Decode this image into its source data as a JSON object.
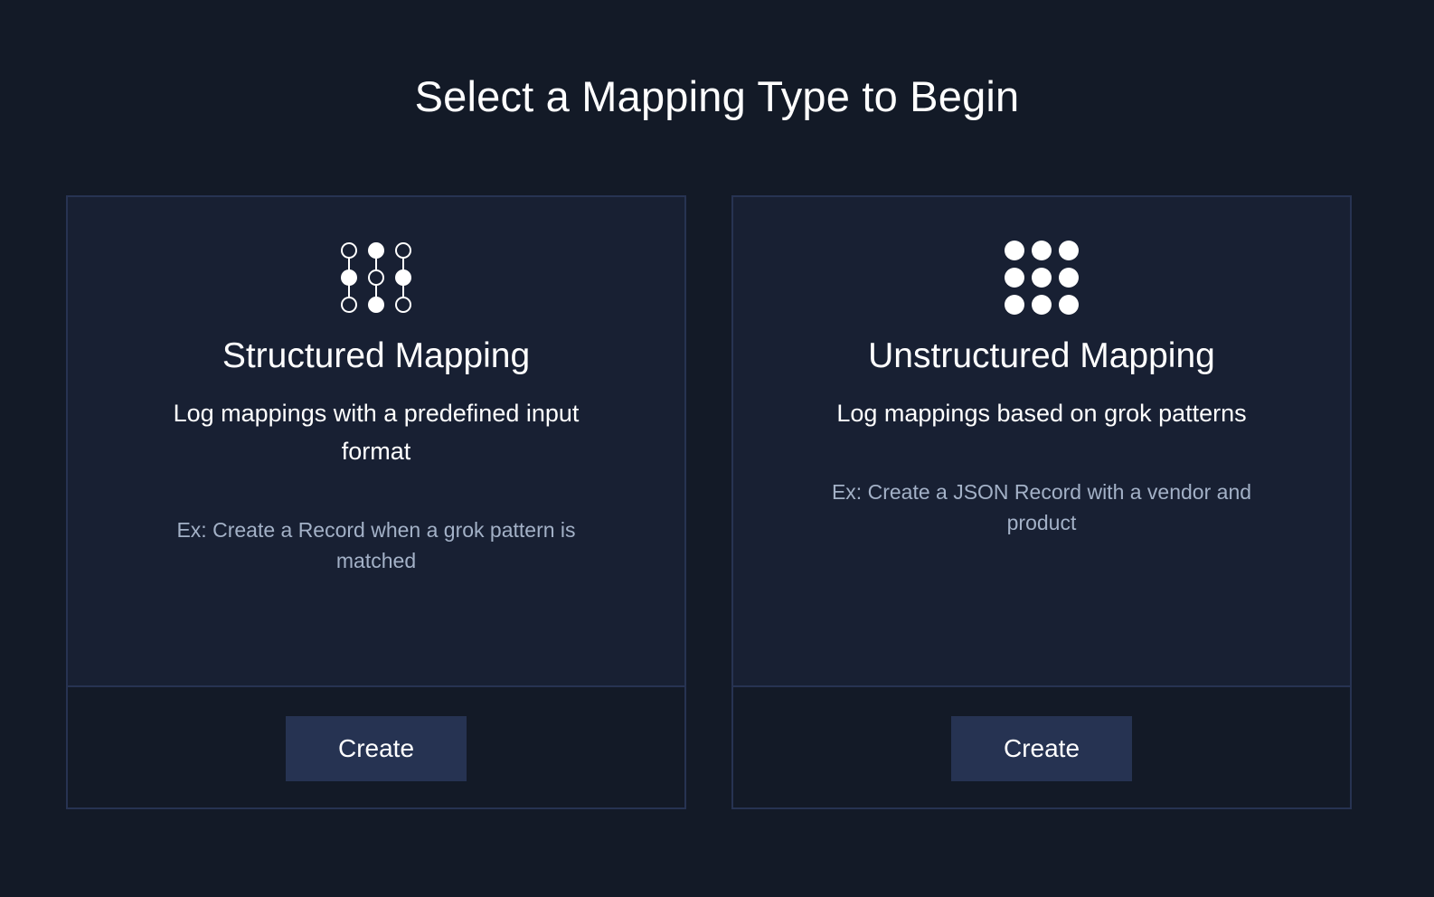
{
  "page": {
    "title": "Select a Mapping Type to Begin"
  },
  "cards": [
    {
      "icon": "structured-mapping-icon",
      "title": "Structured Mapping",
      "description": "Log mappings with a predefined input format",
      "example": "Ex: Create a Record when a grok pattern is matched",
      "button_label": "Create"
    },
    {
      "icon": "unstructured-mapping-icon",
      "title": "Unstructured Mapping",
      "description": "Log mappings based on grok patterns",
      "example": "Ex: Create a JSON Record with a vendor and product",
      "button_label": "Create"
    }
  ],
  "colors": {
    "background": "#131a27",
    "card_body": "#182033",
    "card_border": "#273352",
    "button": "#263352",
    "muted_text": "#a3b1c7"
  }
}
